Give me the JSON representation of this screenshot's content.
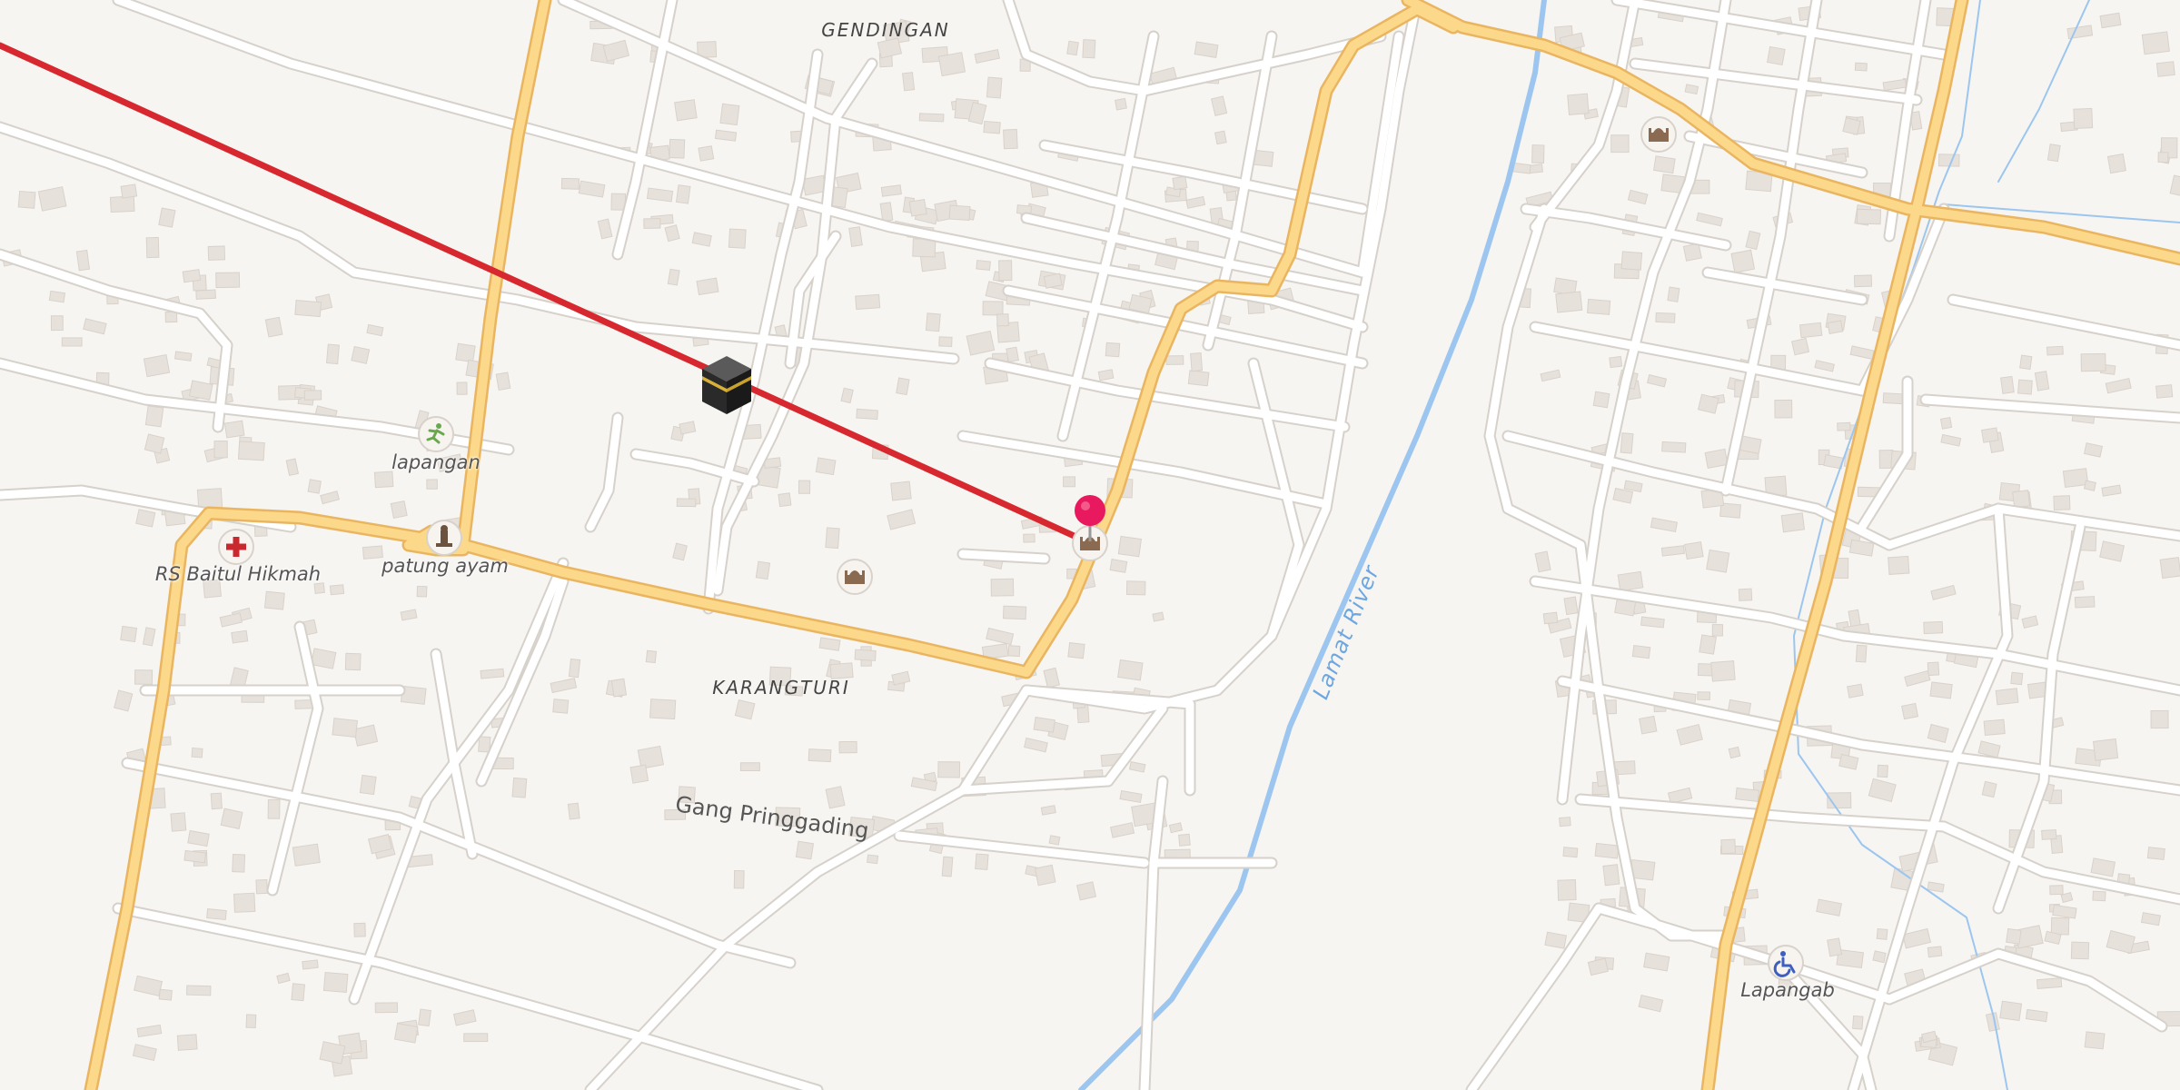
{
  "map": {
    "places": {
      "gendingan": "GENDINGAN",
      "karangturi": "KARANGTURI",
      "lapangan": "lapangan",
      "rs_baitul_hikmah": "RS Baitul Hikmah",
      "patung_ayam": "patung ayam",
      "lapangab": "Lapangab"
    },
    "streets": {
      "gang_pringgading": "Gang Pringgading"
    },
    "water": {
      "river": "Lamat River"
    },
    "icons": {
      "qibla": "kaaba-icon",
      "pin": "location-pin-icon",
      "mosque": "mosque-icon",
      "hospital": "hospital-cross-icon",
      "sports": "running-person-icon",
      "monument": "monument-icon",
      "disabled": "wheelchair-icon"
    },
    "colors": {
      "background": "#f7f5f2",
      "minor_road": "#ffffff",
      "major_road": "#fcd98a",
      "major_road_casing": "#eab560",
      "building": "#e6e1db",
      "river": "#9cc6ef",
      "qibla_line": "#d7282f",
      "pin": "#e8195e"
    }
  }
}
